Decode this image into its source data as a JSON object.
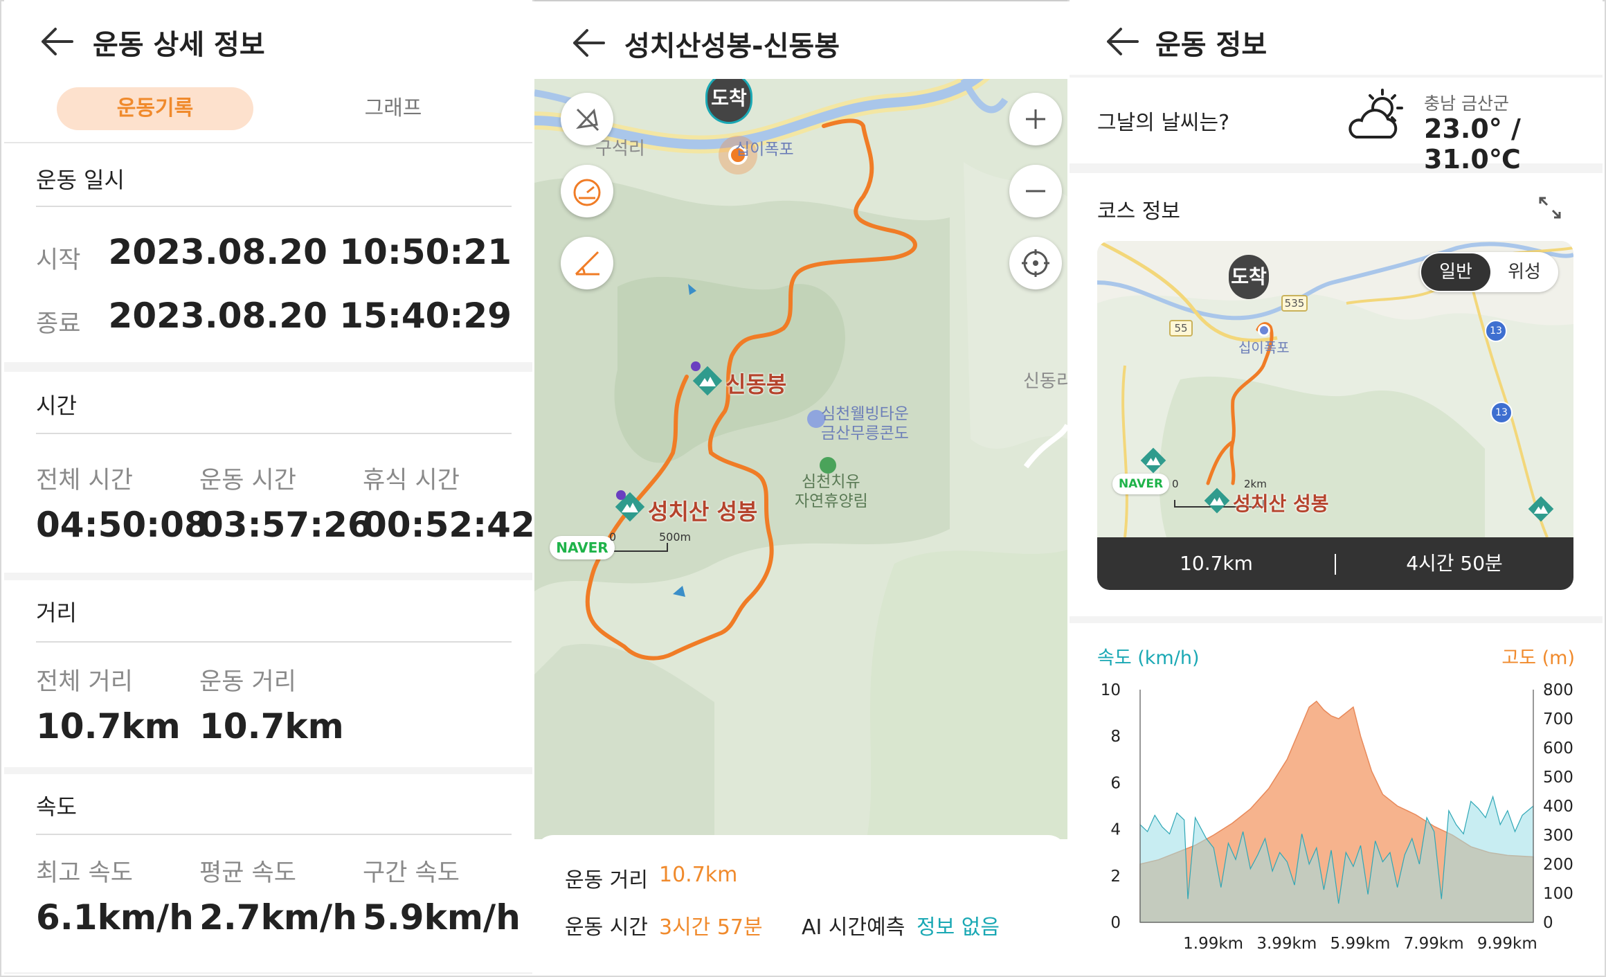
{
  "colors": {
    "accent": "#f08a2c",
    "teal": "#1aa8b4",
    "tab_bg": "#fde1cd",
    "route": "#f07c26"
  },
  "panel1": {
    "title": "운동 상세 정보",
    "tabs": [
      {
        "label": "운동기록",
        "active": true
      },
      {
        "label": "그래프",
        "active": false
      }
    ],
    "datetime": {
      "title": "운동 일시",
      "start_label": "시작",
      "start_value": "2023.08.20 10:50:21",
      "end_label": "종료",
      "end_value": "2023.08.20 15:40:29"
    },
    "time": {
      "title": "시간",
      "items": [
        {
          "label": "전체 시간",
          "value": "04:50:08"
        },
        {
          "label": "운동 시간",
          "value": "03:57:26"
        },
        {
          "label": "휴식 시간",
          "value": "00:52:42"
        }
      ]
    },
    "distance": {
      "title": "거리",
      "items": [
        {
          "label": "전체 거리",
          "value": "10.7km"
        },
        {
          "label": "운동 거리",
          "value": "10.7km"
        }
      ]
    },
    "speed": {
      "title": "속도",
      "items": [
        {
          "label": "최고 속도",
          "value": "6.1km/h"
        },
        {
          "label": "평균 속도",
          "value": "2.7km/h"
        },
        {
          "label": "구간 속도",
          "value": "5.9km/h"
        }
      ]
    }
  },
  "panel2": {
    "title": "성치산성봉-신동봉",
    "map": {
      "arrival_label": "도착",
      "places": {
        "guseokri": "구석리",
        "sipi": "십이폭포",
        "shindong_edge": "신동리",
        "resort_1": "심천웰빙타운",
        "resort_2": "금산무릉콘도",
        "forest_1": "심천치유",
        "forest_2": "자연휴양림"
      },
      "peaks": {
        "shindong": "신동봉",
        "seongbong": "성치산 성봉"
      },
      "logo": "NAVER",
      "scale_zero": "0",
      "scale_label": "500m"
    },
    "stats": {
      "distance_label": "운동 거리",
      "distance_value": "10.7km",
      "time_label": "운동 시간",
      "time_value": "3시간 57분",
      "ai_label": "AI 시간예측",
      "ai_value": "정보 없음"
    }
  },
  "panel3": {
    "title": "운동 정보",
    "weather": {
      "question": "그날의 날씨는?",
      "location": "충남 금산군",
      "temp": "23.0° / 31.0℃",
      "icon": "partly-cloudy-sun-icon"
    },
    "course": {
      "title": "코스 정보",
      "map_toggle": [
        {
          "label": "일반",
          "active": true
        },
        {
          "label": "위성",
          "active": false
        }
      ],
      "arrival_label": "도착",
      "place_sipi": "십이폭포",
      "peak": "성치산 성봉",
      "logo": "NAVER",
      "scale_zero": "0",
      "scale_label": "2km",
      "roads": [
        "55",
        "535",
        "13",
        "13"
      ],
      "summary_distance": "10.7km",
      "summary_time": "4시간 50분"
    }
  },
  "chart_data": {
    "type": "area",
    "speed_label": "속도 (km/h)",
    "elev_label": "고도 (m)",
    "x_ticks": [
      "1.99km",
      "3.99km",
      "5.99km",
      "7.99km",
      "9.99km"
    ],
    "xlim": [
      0,
      10.7
    ],
    "y_left_ticks": [
      "10",
      "8",
      "6",
      "4",
      "2",
      "0"
    ],
    "y_left_lim": [
      0,
      10
    ],
    "y_right_ticks": [
      "800",
      "700",
      "600",
      "500",
      "400",
      "300",
      "200",
      "100",
      "0"
    ],
    "y_right_lim": [
      0,
      800
    ],
    "series": [
      {
        "name": "고도 (m)",
        "axis": "right",
        "color": "#f6b38d",
        "x": [
          0,
          0.5,
          1.0,
          1.5,
          2.0,
          2.5,
          3.0,
          3.5,
          4.0,
          4.3,
          4.6,
          4.8,
          5.0,
          5.2,
          5.4,
          5.6,
          5.8,
          6.0,
          6.3,
          6.6,
          7.0,
          7.5,
          8.0,
          8.5,
          9.0,
          9.5,
          10.0,
          10.7
        ],
        "y": [
          200,
          215,
          240,
          265,
          300,
          340,
          390,
          460,
          560,
          650,
          740,
          760,
          730,
          710,
          700,
          720,
          740,
          640,
          520,
          440,
          400,
          370,
          330,
          300,
          260,
          240,
          230,
          225
        ]
      },
      {
        "name": "속도 (km/h)",
        "axis": "left",
        "color": "#9bdfe8",
        "x": [
          0,
          0.2,
          0.4,
          0.6,
          0.8,
          1.0,
          1.2,
          1.3,
          1.5,
          1.8,
          2.0,
          2.2,
          2.4,
          2.6,
          2.8,
          3.0,
          3.2,
          3.4,
          3.6,
          3.8,
          4.0,
          4.2,
          4.4,
          4.6,
          4.8,
          5.0,
          5.2,
          5.4,
          5.6,
          5.8,
          6.0,
          6.2,
          6.4,
          6.6,
          6.8,
          7.0,
          7.2,
          7.4,
          7.6,
          7.8,
          8.0,
          8.2,
          8.4,
          8.6,
          8.8,
          9.0,
          9.2,
          9.4,
          9.6,
          9.8,
          10.0,
          10.2,
          10.4,
          10.7
        ],
        "y": [
          4.2,
          3.9,
          4.6,
          4.1,
          3.8,
          4.7,
          4.4,
          1.0,
          4.5,
          3.6,
          3.2,
          1.5,
          3.4,
          2.7,
          3.9,
          2.3,
          2.9,
          3.6,
          2.2,
          3.0,
          2.6,
          1.6,
          3.8,
          2.5,
          3.2,
          1.4,
          3.1,
          0.8,
          3.0,
          2.4,
          3.3,
          1.2,
          3.5,
          2.6,
          3.0,
          1.5,
          2.9,
          3.6,
          2.5,
          4.5,
          3.9,
          1.0,
          4.8,
          4.2,
          3.8,
          5.2,
          4.9,
          4.5,
          5.4,
          4.2,
          4.8,
          3.9,
          4.6,
          5.0
        ]
      }
    ]
  }
}
